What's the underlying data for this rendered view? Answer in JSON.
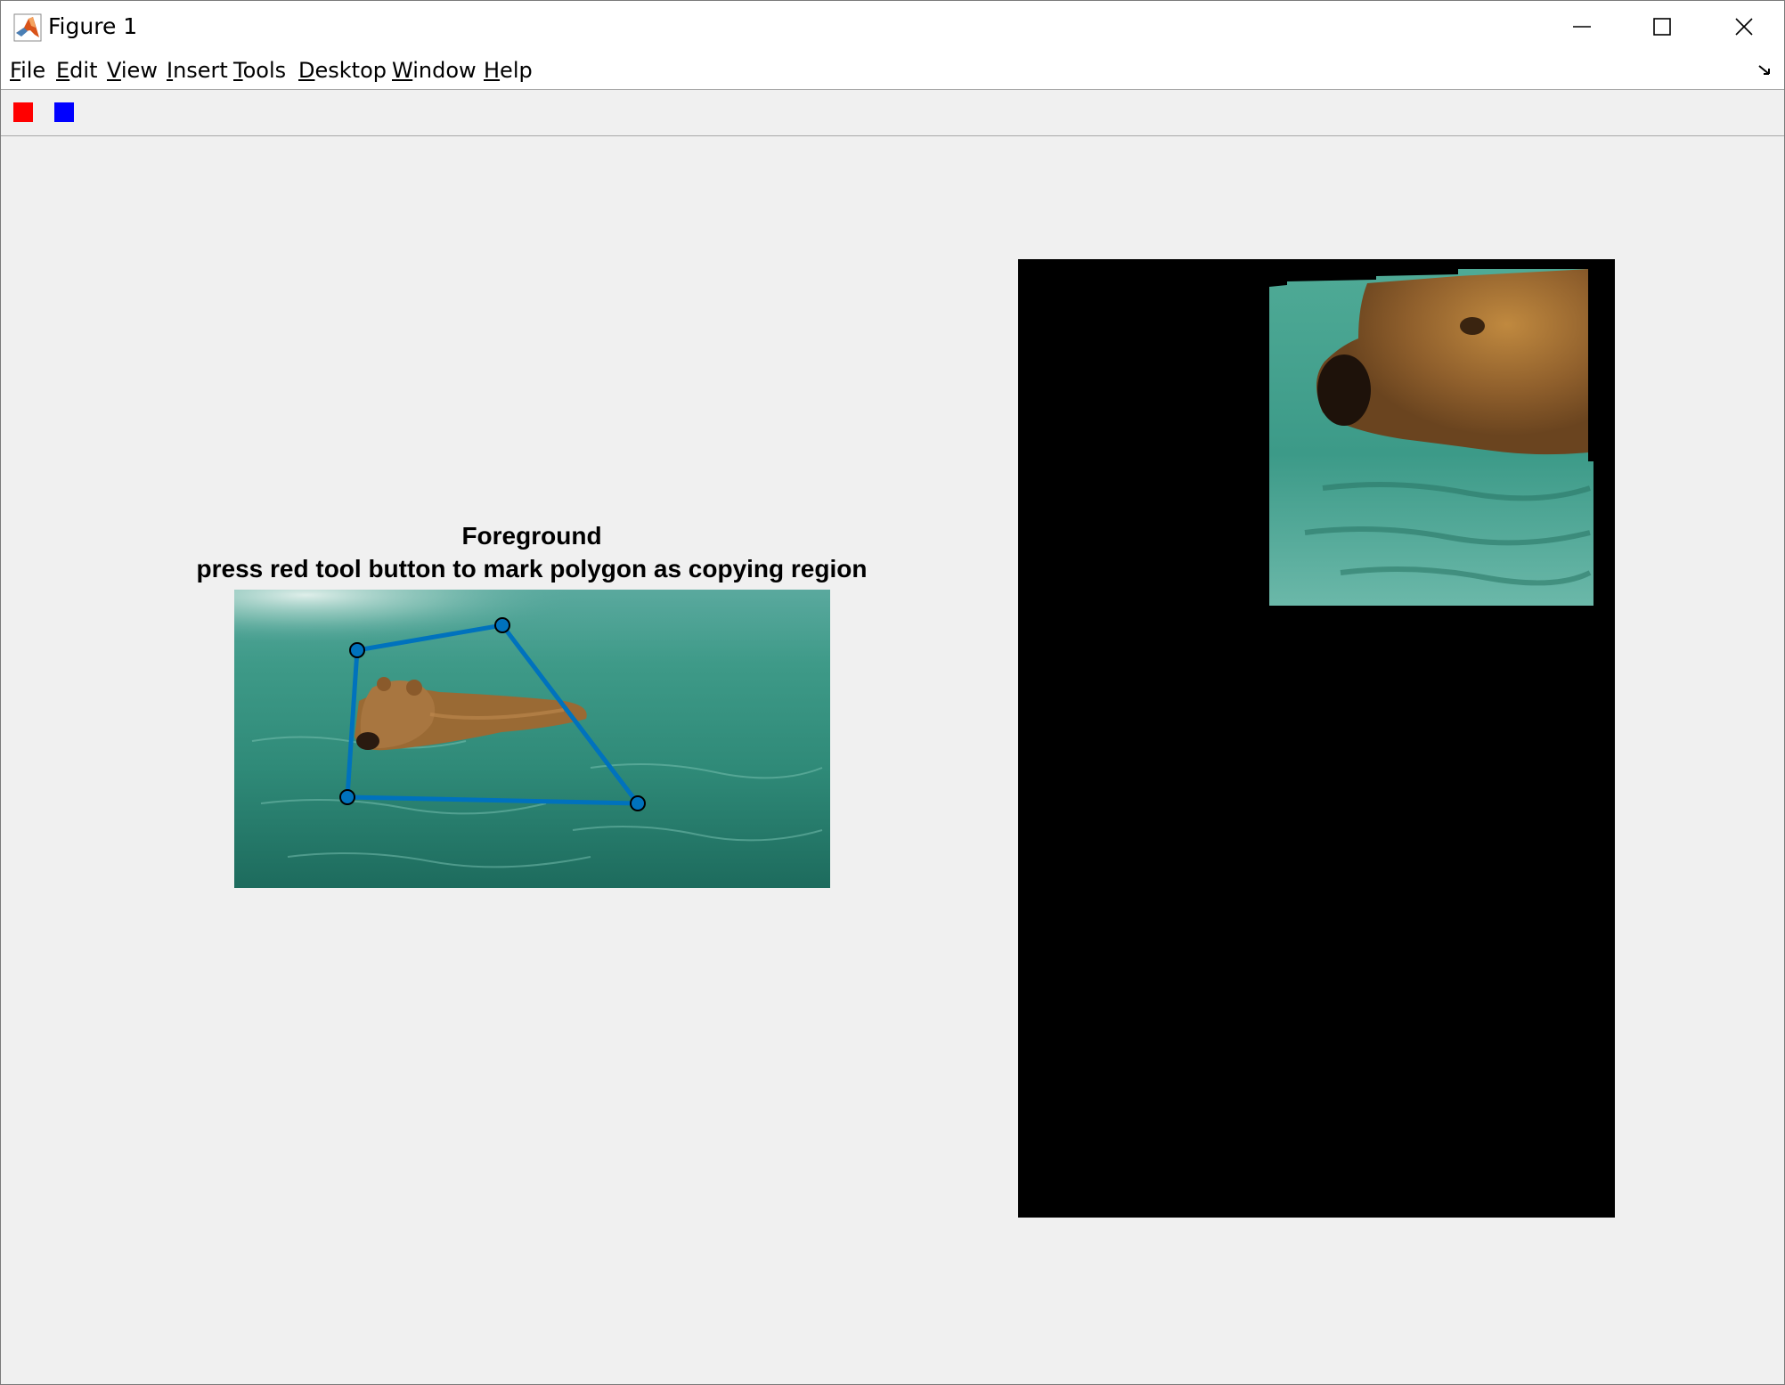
{
  "window": {
    "title": "Figure 1",
    "icon": "matlab-logo-icon",
    "controls": [
      "minimize-icon",
      "maximize-icon",
      "close-icon"
    ]
  },
  "menu": {
    "items": [
      {
        "label": "File",
        "underline": "F",
        "rest": "ile"
      },
      {
        "label": "Edit",
        "underline": "E",
        "rest": "dit"
      },
      {
        "label": "View",
        "underline": "V",
        "rest": "iew"
      },
      {
        "label": "Insert",
        "underline": "I",
        "rest": "nsert"
      },
      {
        "label": "Tools",
        "underline": "T",
        "rest": "ools"
      },
      {
        "label": "Desktop",
        "underline": "D",
        "rest": "esktop"
      },
      {
        "label": "Window",
        "underline": "W",
        "rest": "indow"
      },
      {
        "label": "Help",
        "underline": "H",
        "rest": "elp"
      }
    ]
  },
  "toolbar": {
    "buttons": [
      {
        "name": "red-tool-button",
        "color": "#ff0000"
      },
      {
        "name": "blue-tool-button",
        "color": "#0000ff"
      }
    ]
  },
  "foreground_axes": {
    "title_line1": "Foreground",
    "title_line2": "press red tool button to mark polygon as copying region",
    "polygon_color": "#0072bd"
  }
}
